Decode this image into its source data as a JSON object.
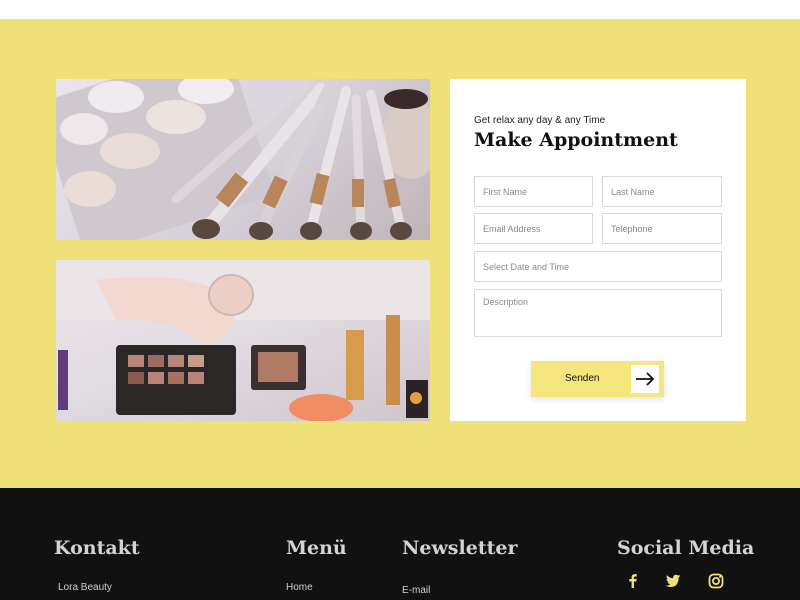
{
  "colors": {
    "accent": "#f0e078",
    "button": "#f5e57d",
    "footer": "#111111"
  },
  "images": {
    "brushes": "makeup-brushes-photo",
    "makeup": "makeup-palette-hand-photo"
  },
  "form": {
    "subtitle": "Get relax any day & any Time",
    "title": "Make Appointment",
    "first_name": "First Name",
    "last_name": "Last Name",
    "email": "Email Address",
    "telephone": "Telephone",
    "date_time": "Select Date and Time",
    "description": "Description",
    "submit_label": "Senden",
    "submit_icon": "arrow-right-icon"
  },
  "footer": {
    "contact": {
      "heading": "Kontakt",
      "company": "Lora Beauty"
    },
    "menu": {
      "heading": "Menü",
      "items": [
        "Home"
      ]
    },
    "newsletter": {
      "heading": "Newsletter",
      "email_label": "E-mail"
    },
    "social": {
      "heading": "Social Media",
      "icons": [
        "facebook-icon",
        "twitter-icon",
        "instagram-icon"
      ]
    }
  }
}
